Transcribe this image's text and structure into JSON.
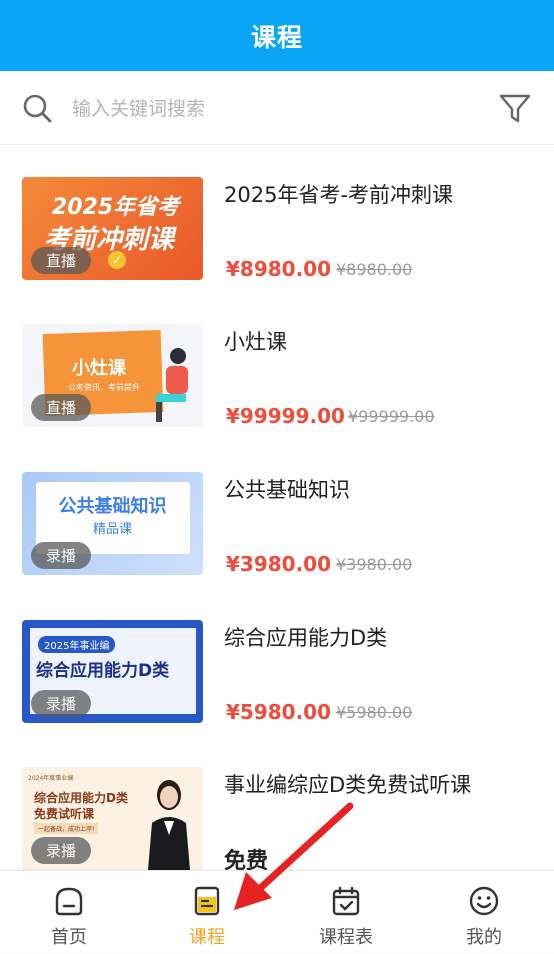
{
  "header": {
    "title": "课程"
  },
  "search": {
    "placeholder": "输入关键词搜索"
  },
  "courses": [
    {
      "title": "2025年省考-考前冲刺课",
      "price": "¥8980.00",
      "original": "¥8980.00",
      "badge": "直播",
      "thumb_text": [
        "2025年省考",
        "考前冲刺课"
      ]
    },
    {
      "title": "小灶课",
      "price": "¥99999.00",
      "original": "¥99999.00",
      "badge": "直播",
      "thumb_text": [
        "小灶课",
        "公考资讯，考前提升"
      ]
    },
    {
      "title": "公共基础知识",
      "price": "¥3980.00",
      "original": "¥3980.00",
      "badge": "录播",
      "thumb_text": [
        "公共基础知识",
        "精品课"
      ]
    },
    {
      "title": "综合应用能力D类",
      "price": "¥5980.00",
      "original": "¥5980.00",
      "badge": "录播",
      "thumb_text": [
        "2025年事业编",
        "综合应用能力D类"
      ]
    },
    {
      "title": "事业编综应D类免费试听课",
      "price_label": "免费",
      "badge": "录播",
      "thumb_text": [
        "2024年度事业编",
        "综合应用能力D类",
        "免费试听课",
        "一起备战，成功上岸!"
      ]
    }
  ],
  "tabs": [
    {
      "label": "首页",
      "icon": "home-icon"
    },
    {
      "label": "课程",
      "icon": "course-icon",
      "active": true
    },
    {
      "label": "课程表",
      "icon": "calendar-icon"
    },
    {
      "label": "我的",
      "icon": "smile-icon"
    }
  ],
  "colors": {
    "header": "#0aa5f5",
    "price": "#f04b3c",
    "active_tab": "#f5a623",
    "arrow": "#e62222"
  }
}
